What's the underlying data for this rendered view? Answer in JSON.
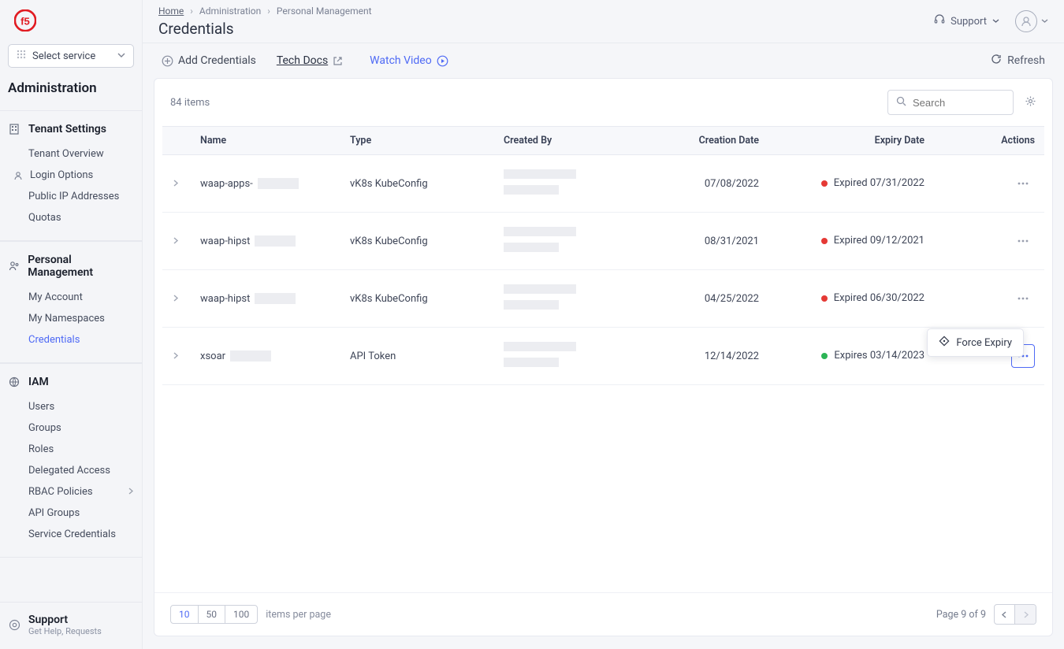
{
  "sidebar": {
    "select_service": "Select service",
    "admin_heading": "Administration",
    "groups": [
      {
        "title": "Tenant Settings",
        "items": [
          "Tenant Overview",
          "Login Options",
          "Public IP Addresses",
          "Quotas"
        ]
      },
      {
        "title": "Personal Management",
        "items": [
          "My Account",
          "My Namespaces",
          "Credentials"
        ]
      },
      {
        "title": "IAM",
        "items": [
          "Users",
          "Groups",
          "Roles",
          "Delegated Access",
          "RBAC Policies",
          "API Groups",
          "Service Credentials"
        ]
      }
    ],
    "support_title": "Support",
    "support_sub": "Get Help, Requests"
  },
  "breadcrumbs": {
    "home": "Home",
    "mid": "Administration",
    "leaf": "Personal Management"
  },
  "page_title": "Credentials",
  "topbar": {
    "support": "Support"
  },
  "actions": {
    "add": "Add Credentials",
    "tech_docs": "Tech Docs",
    "watch_video": "Watch Video",
    "refresh": "Refresh"
  },
  "table": {
    "items_count": "84 items",
    "search_placeholder": "Search",
    "columns": {
      "name": "Name",
      "type": "Type",
      "created_by": "Created By",
      "creation_date": "Creation Date",
      "expiry": "Expiry Date",
      "actions": "Actions"
    },
    "rows": [
      {
        "name_prefix": "waap-apps-",
        "type": "vK8s KubeConfig",
        "creation_date": "07/08/2022",
        "expiry_status": "red",
        "expiry_text": "Expired 07/31/2022"
      },
      {
        "name_prefix": "waap-hipst",
        "type": "vK8s KubeConfig",
        "creation_date": "08/31/2021",
        "expiry_status": "red",
        "expiry_text": "Expired 09/12/2021"
      },
      {
        "name_prefix": "waap-hipst",
        "type": "vK8s KubeConfig",
        "creation_date": "04/25/2022",
        "expiry_status": "red",
        "expiry_text": "Expired 06/30/2022"
      },
      {
        "name_prefix": "xsoar",
        "type": "API Token",
        "creation_date": "12/14/2022",
        "expiry_status": "green",
        "expiry_text": "Expires 03/14/2023"
      }
    ]
  },
  "popover": {
    "force_expiry": "Force Expiry"
  },
  "pagination": {
    "sizes": [
      "10",
      "50",
      "100"
    ],
    "items_per_page": "items per page",
    "page_info": "Page 9 of 9"
  }
}
